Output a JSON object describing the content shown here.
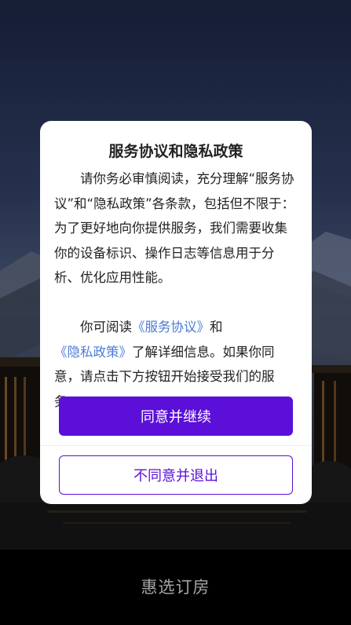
{
  "dialog": {
    "title": "服务协议和隐私政策",
    "paragraph1": "请你务必审慎阅读，充分理解“服务协议”和“隐私政策”各条款，包括但不限于：为了更好地向你提供服务，我们需要收集你的设备标识、操作日志等信息用于分析、优化应用性能。",
    "paragraph2_prefix": "你可阅读",
    "service_link": "《服务协议》",
    "and_text": "和",
    "privacy_link": "《隐私政策》",
    "paragraph2_suffix": "了解详细信息。如果你同意，请点击下方按钮开始接受我们的服务。",
    "agree_label": "同意并继续",
    "reject_label": "不同意并退出"
  },
  "app": {
    "brand_title": "惠选订房"
  },
  "colors": {
    "accent": "#5b0fd8",
    "link": "#4a7bd9",
    "dialog_bg": "#ffffff"
  }
}
